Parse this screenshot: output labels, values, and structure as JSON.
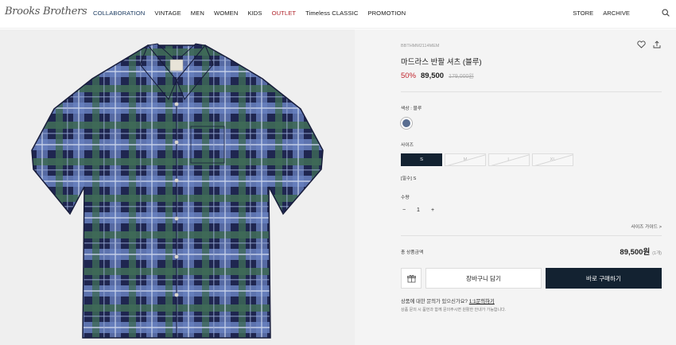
{
  "header": {
    "logo": "Brooks Brothers",
    "nav": [
      {
        "label": "COLLABORATION",
        "style": "active"
      },
      {
        "label": "VINTAGE",
        "style": ""
      },
      {
        "label": "MEN",
        "style": ""
      },
      {
        "label": "WOMEN",
        "style": ""
      },
      {
        "label": "KIDS",
        "style": ""
      },
      {
        "label": "OUTLET",
        "style": "outlet"
      },
      {
        "label": "Timeless CLASSIC",
        "style": ""
      },
      {
        "label": "PROMOTION",
        "style": ""
      }
    ],
    "right_links": {
      "store": "STORE",
      "archive": "ARCHIVE"
    },
    "search_icon": "search-icon"
  },
  "product": {
    "code": "BBTHMM2114MEM",
    "name": "마드라스 반팔 셔츠 (블루)",
    "discount": "50%",
    "price": "89,500",
    "original_price": "179,000원",
    "color_label": "색상 : 블루",
    "color_hex": "#5a6e91",
    "size_label": "사이즈",
    "sizes": [
      {
        "label": "S",
        "state": "selected"
      },
      {
        "label": "M",
        "state": "disabled"
      },
      {
        "label": "L",
        "state": "disabled"
      },
      {
        "label": "XL",
        "state": "disabled"
      }
    ],
    "selected_size": "[필수] S",
    "qty_label": "수량",
    "qty_minus": "−",
    "qty_value": "1",
    "qty_plus": "+",
    "size_guide": "사이즈 가이드 >",
    "total_label": "총 상품금액",
    "total_price": "89,500원",
    "total_count": "(1개)",
    "cart_button": "장바구니 담기",
    "buy_button": "바로 구매하기",
    "inquiry_text": "상품에 대한 문의가 있으신가요?",
    "inquiry_link": "1:1문의하기",
    "inquiry_note": "상품 문의 시 품번과 함께 문의주시면 원활한 안내가 가능합니다."
  },
  "colors": {
    "navy": "#132231",
    "sale_red": "#c0232c",
    "collab_blue": "#17375e"
  }
}
